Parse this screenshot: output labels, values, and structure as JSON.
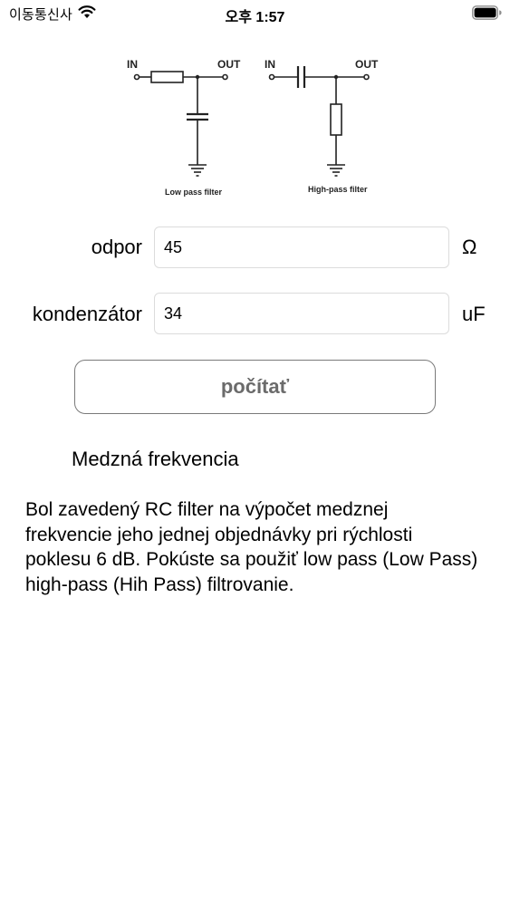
{
  "status_bar": {
    "carrier": "이동통신사",
    "time": "오후 1:57",
    "icons": [
      "wifi-icon",
      "battery-icon"
    ]
  },
  "diagram": {
    "in_label": "IN",
    "out_label": "OUT",
    "low_pass_caption": "Low pass filter",
    "high_pass_caption": "High-pass filter"
  },
  "form": {
    "resistance": {
      "label": "odpor",
      "value": "45",
      "unit": "Ω"
    },
    "capacitor": {
      "label": "kondenzátor",
      "value": "34",
      "unit": "uF"
    },
    "calculate_label": "počítať"
  },
  "result": {
    "label": "Medzná frekvencia"
  },
  "description": "Bol zavedený RC filter na výpočet medznej frekvencie jeho jednej objednávky pri rýchlosti poklesu 6 dB. Pokúste sa použiť low pass (Low Pass) high-pass (Hih Pass) filtrovanie."
}
